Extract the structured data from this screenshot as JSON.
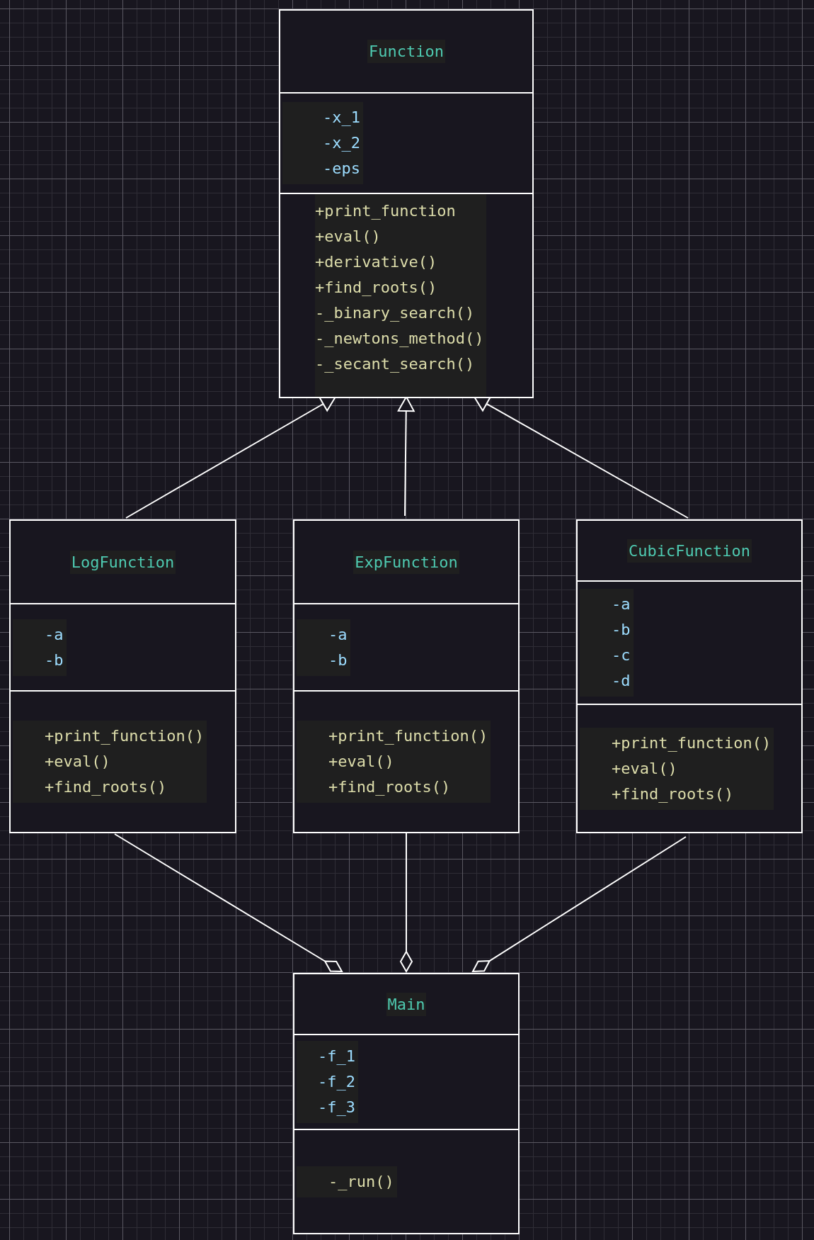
{
  "classes": [
    {
      "name": "Function",
      "attributes": [
        "-x_1",
        "-x_2",
        "-eps"
      ],
      "methods": [
        "+print_function",
        "+eval()",
        "+derivative()",
        "+find_roots()",
        "-_binary_search()",
        "-_newtons_method()",
        "-_secant_search()"
      ]
    },
    {
      "name": "LogFunction",
      "attributes": [
        "-a",
        "-b"
      ],
      "methods": [
        "+print_function()",
        "+eval()",
        "+find_roots()"
      ],
      "links": [
        {
          "kind": "inheritance"
        },
        {
          "kind": "aggregation"
        }
      ]
    },
    {
      "name": "ExpFunction",
      "attributes": [
        "-a",
        "-b"
      ],
      "methods": [
        "+print_function()",
        "+eval()",
        "+find_roots()"
      ],
      "links": [
        {
          "kind": "inheritance"
        },
        {
          "kind": "aggregation"
        }
      ]
    },
    {
      "name": "CubicFunction",
      "attributes": [
        "-a",
        "-b",
        "-c",
        "-d"
      ],
      "methods": [
        "+print_function()",
        "+eval()",
        "+find_roots()"
      ],
      "links": [
        {
          "kind": "inheritance"
        },
        {
          "kind": "aggregation"
        }
      ]
    },
    {
      "name": "Main",
      "attributes": [
        "-f_1",
        "-f_2",
        "-f_3"
      ],
      "methods": [
        "-_run()"
      ]
    }
  ]
}
